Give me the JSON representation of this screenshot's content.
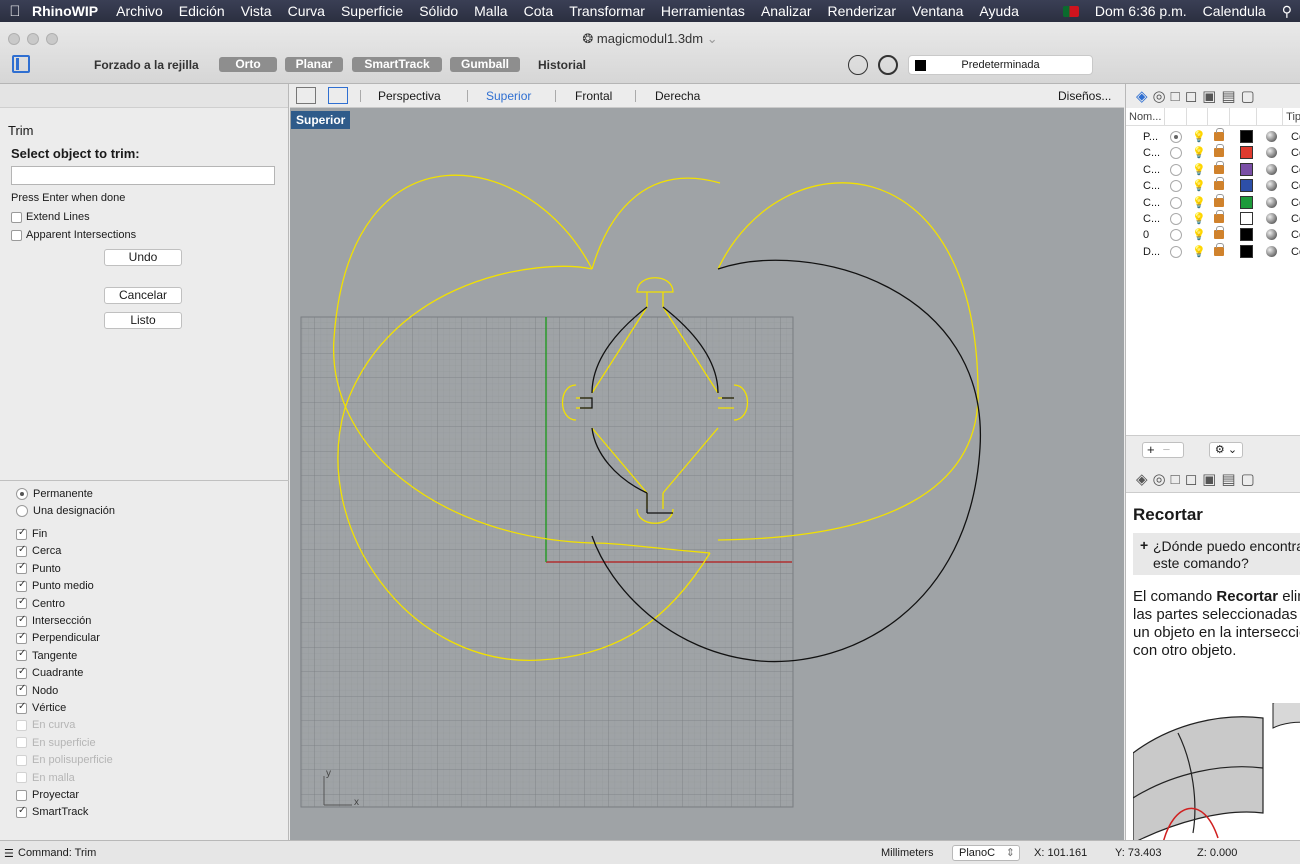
{
  "menubar": {
    "app": "RhinoWIP",
    "items": [
      "Archivo",
      "Edición",
      "Vista",
      "Curva",
      "Superficie",
      "Sólido",
      "Malla",
      "Cota",
      "Transformar",
      "Herramientas",
      "Analizar",
      "Renderizar",
      "Ventana",
      "Ayuda"
    ],
    "clock": "Dom 6:36 p.m.",
    "calendar": "Calendula"
  },
  "window": {
    "title": "magicmodul1.3dm"
  },
  "toolbar": {
    "grid_snap": "Forzado a la rejilla",
    "ortho": "Orto",
    "planar": "Planar",
    "smarttrack": "SmartTrack",
    "gumball": "Gumball",
    "history": "Historial",
    "layer": "Predeterminada"
  },
  "command": {
    "name": "Trim",
    "prompt": "Select object to trim:",
    "input_value": "",
    "hint": "Press Enter when done",
    "extend_lines": "Extend Lines",
    "apparent": "Apparent Intersections",
    "undo": "Undo",
    "cancel": "Cancelar",
    "done": "Listo"
  },
  "osnap": {
    "permanent": "Permanente",
    "single": "Una designación",
    "items": [
      {
        "label": "Fin",
        "checked": true,
        "enabled": true
      },
      {
        "label": "Cerca",
        "checked": true,
        "enabled": true
      },
      {
        "label": "Punto",
        "checked": true,
        "enabled": true
      },
      {
        "label": "Punto medio",
        "checked": true,
        "enabled": true
      },
      {
        "label": "Centro",
        "checked": true,
        "enabled": true
      },
      {
        "label": "Intersección",
        "checked": true,
        "enabled": true
      },
      {
        "label": "Perpendicular",
        "checked": true,
        "enabled": true
      },
      {
        "label": "Tangente",
        "checked": true,
        "enabled": true
      },
      {
        "label": "Cuadrante",
        "checked": true,
        "enabled": true
      },
      {
        "label": "Nodo",
        "checked": true,
        "enabled": true
      },
      {
        "label": "Vértice",
        "checked": true,
        "enabled": true
      },
      {
        "label": "En curva",
        "checked": false,
        "enabled": false
      },
      {
        "label": "En superficie",
        "checked": false,
        "enabled": false
      },
      {
        "label": "En polisuperficie",
        "checked": false,
        "enabled": false
      },
      {
        "label": "En malla",
        "checked": false,
        "enabled": false
      },
      {
        "label": "Proyectar",
        "checked": false,
        "enabled": true
      },
      {
        "label": "SmartTrack",
        "checked": true,
        "enabled": true
      }
    ]
  },
  "viewport": {
    "tabs": [
      "Perspectiva",
      "Superior",
      "Frontal",
      "Derecha"
    ],
    "active_tab": "Superior",
    "layouts": "Diseños...",
    "label": "Superior",
    "axis_y": "y",
    "axis_x": "x"
  },
  "layers": {
    "headers": [
      "Nom...",
      "Tip"
    ],
    "rows": [
      {
        "name": "P...",
        "current": true,
        "on": true,
        "color": "#000000",
        "type": "Co"
      },
      {
        "name": "C...",
        "current": false,
        "on": true,
        "color": "#e03a2e",
        "type": "Co"
      },
      {
        "name": "C...",
        "current": false,
        "on": true,
        "color": "#7a4fa6",
        "type": "Co"
      },
      {
        "name": "C...",
        "current": false,
        "on": true,
        "color": "#2d4fa8",
        "type": "Co"
      },
      {
        "name": "C...",
        "current": false,
        "on": true,
        "color": "#1d9b3a",
        "type": "Co"
      },
      {
        "name": "C...",
        "current": false,
        "on": false,
        "color": "#ffffff",
        "type": "Co"
      },
      {
        "name": "0",
        "current": false,
        "on": false,
        "color": "#000000",
        "type": "Co"
      },
      {
        "name": "D...",
        "current": false,
        "on": false,
        "color": "#000000",
        "type": "Co"
      }
    ]
  },
  "help": {
    "title": "Recortar",
    "faq": "¿Dónde puedo encontrar este comando?",
    "text_pre": "El comando ",
    "text_bold": "Recortar",
    "text_post": " elimina las partes seleccionadas de un objeto en la intersección con otro objeto."
  },
  "status": {
    "command": "Command: Trim",
    "units": "Millimeters",
    "plane": "PlanoC",
    "x": "X: 101.161",
    "y": "Y: 73.403",
    "z": "Z: 0.000"
  },
  "colors": {
    "yellow_curve": "#f2e100",
    "black_curve": "#111111",
    "x_axis": "#b03030",
    "y_axis": "#2a9a2a",
    "viewport_bg": "#9fa3a6",
    "accent": "#2f6fd1"
  }
}
